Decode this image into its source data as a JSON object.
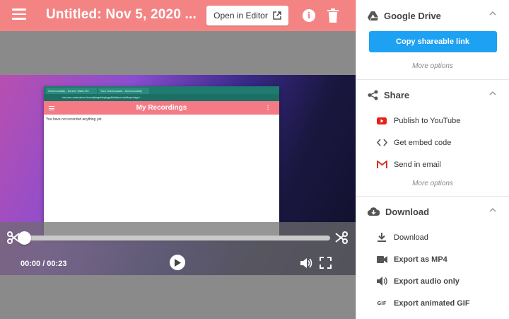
{
  "topbar": {
    "title": "Untitled: Nov 5, 2020 ...",
    "open_editor_label": "Open in Editor"
  },
  "recording": {
    "tabs": [
      "Screencastify - Screen Video Re",
      "Your Screencasts - Screencastify"
    ],
    "url": "chrome-extension://mmeijimgabbpbgpdklnllpncmdofkcpn/app/...",
    "app_title": "My Recordings",
    "empty_message": "You have not recorded anything yet."
  },
  "player": {
    "timecode": "00:00 / 00:23",
    "progress_fraction": 0
  },
  "sidebar": {
    "google_drive": {
      "title": "Google Drive",
      "copy_link_label": "Copy shareable link",
      "more_options": "More options"
    },
    "share": {
      "title": "Share",
      "items": [
        {
          "label": "Publish to YouTube",
          "icon": "youtube-icon"
        },
        {
          "label": "Get embed code",
          "icon": "code-icon"
        },
        {
          "label": "Send in email",
          "icon": "gmail-icon"
        }
      ],
      "more_options": "More options"
    },
    "download": {
      "title": "Download",
      "items": [
        {
          "label": "Download",
          "icon": "download-icon"
        },
        {
          "label": "Export as MP4",
          "icon": "video-camera-icon"
        },
        {
          "label": "Export audio only",
          "icon": "speaker-icon"
        },
        {
          "label": "Export animated GIF",
          "icon": "gif-icon"
        }
      ]
    }
  },
  "colors": {
    "header": "#f48484",
    "primary_button": "#1da1f2",
    "youtube_red": "#e62117"
  }
}
